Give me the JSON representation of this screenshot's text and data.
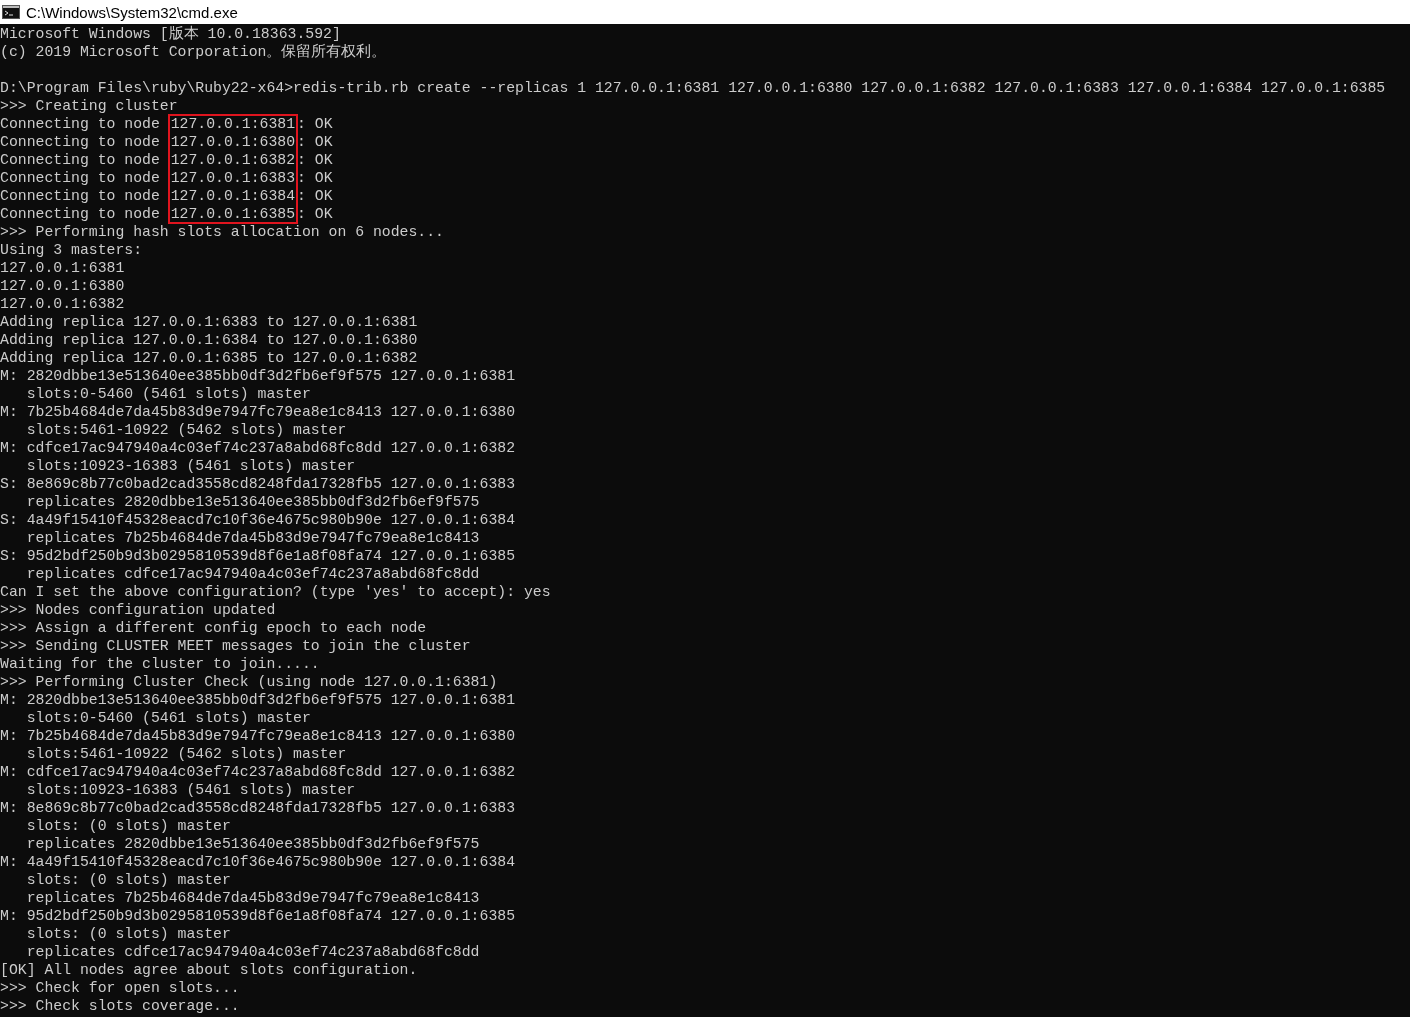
{
  "window": {
    "title": "C:\\Windows\\System32\\cmd.exe"
  },
  "console": [
    {
      "kind": "text",
      "lines": [
        "Microsoft Windows [版本 10.0.18363.592]",
        "(c) 2019 Microsoft Corporation。保留所有权利。"
      ]
    },
    {
      "kind": "blank"
    },
    {
      "kind": "text",
      "lines": [
        "D:\\Program Files\\ruby\\Ruby22-x64>redis-trib.rb create --replicas 1 127.0.0.1:6381 127.0.0.1:6380 127.0.0.1:6382 127.0.0.1:6383 127.0.0.1:6384 127.0.0.1:6385",
        ">>> Creating cluster"
      ]
    },
    {
      "kind": "marked",
      "rows": [
        {
          "before": "Connecting to node ",
          "marked": "127.0.0.1:6381",
          "after": ": OK"
        },
        {
          "before": "Connecting to node ",
          "marked": "127.0.0.1:6380",
          "after": ": OK"
        },
        {
          "before": "Connecting to node ",
          "marked": "127.0.0.1:6382",
          "after": ": OK"
        },
        {
          "before": "Connecting to node ",
          "marked": "127.0.0.1:6383",
          "after": ": OK"
        },
        {
          "before": "Connecting to node ",
          "marked": "127.0.0.1:6384",
          "after": ": OK"
        },
        {
          "before": "Connecting to node ",
          "marked": "127.0.0.1:6385",
          "after": ": OK"
        }
      ]
    },
    {
      "kind": "text",
      "lines": [
        ">>> Performing hash slots allocation on 6 nodes...",
        "Using 3 masters:",
        "127.0.0.1:6381",
        "127.0.0.1:6380",
        "127.0.0.1:6382",
        "Adding replica 127.0.0.1:6383 to 127.0.0.1:6381",
        "Adding replica 127.0.0.1:6384 to 127.0.0.1:6380",
        "Adding replica 127.0.0.1:6385 to 127.0.0.1:6382",
        "M: 2820dbbe13e513640ee385bb0df3d2fb6ef9f575 127.0.0.1:6381",
        "   slots:0-5460 (5461 slots) master",
        "M: 7b25b4684de7da45b83d9e7947fc79ea8e1c8413 127.0.0.1:6380",
        "   slots:5461-10922 (5462 slots) master",
        "M: cdfce17ac947940a4c03ef74c237a8abd68fc8dd 127.0.0.1:6382",
        "   slots:10923-16383 (5461 slots) master",
        "S: 8e869c8b77c0bad2cad3558cd8248fda17328fb5 127.0.0.1:6383",
        "   replicates 2820dbbe13e513640ee385bb0df3d2fb6ef9f575",
        "S: 4a49f15410f45328eacd7c10f36e4675c980b90e 127.0.0.1:6384",
        "   replicates 7b25b4684de7da45b83d9e7947fc79ea8e1c8413",
        "S: 95d2bdf250b9d3b0295810539d8f6e1a8f08fa74 127.0.0.1:6385",
        "   replicates cdfce17ac947940a4c03ef74c237a8abd68fc8dd",
        "Can I set the above configuration? (type 'yes' to accept): yes",
        ">>> Nodes configuration updated",
        ">>> Assign a different config epoch to each node",
        ">>> Sending CLUSTER MEET messages to join the cluster",
        "Waiting for the cluster to join.....",
        ">>> Performing Cluster Check (using node 127.0.0.1:6381)",
        "M: 2820dbbe13e513640ee385bb0df3d2fb6ef9f575 127.0.0.1:6381",
        "   slots:0-5460 (5461 slots) master",
        "M: 7b25b4684de7da45b83d9e7947fc79ea8e1c8413 127.0.0.1:6380",
        "   slots:5461-10922 (5462 slots) master",
        "M: cdfce17ac947940a4c03ef74c237a8abd68fc8dd 127.0.0.1:6382",
        "   slots:10923-16383 (5461 slots) master",
        "M: 8e869c8b77c0bad2cad3558cd8248fda17328fb5 127.0.0.1:6383",
        "   slots: (0 slots) master",
        "   replicates 2820dbbe13e513640ee385bb0df3d2fb6ef9f575",
        "M: 4a49f15410f45328eacd7c10f36e4675c980b90e 127.0.0.1:6384",
        "   slots: (0 slots) master",
        "   replicates 7b25b4684de7da45b83d9e7947fc79ea8e1c8413",
        "M: 95d2bdf250b9d3b0295810539d8f6e1a8f08fa74 127.0.0.1:6385",
        "   slots: (0 slots) master",
        "   replicates cdfce17ac947940a4c03ef74c237a8abd68fc8dd",
        "[OK] All nodes agree about slots configuration.",
        ">>> Check for open slots...",
        ">>> Check slots coverage..."
      ]
    }
  ]
}
